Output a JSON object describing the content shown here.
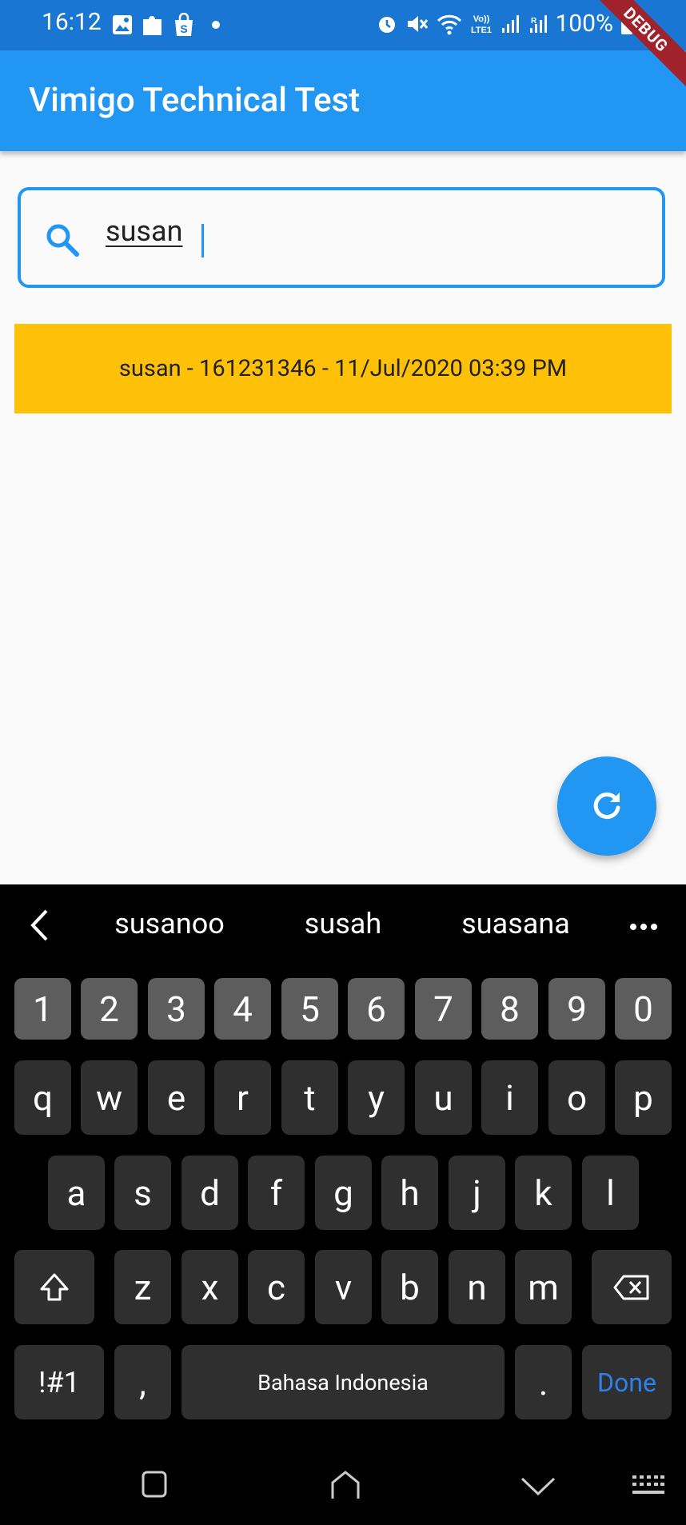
{
  "status_bar": {
    "time": "16:12",
    "battery": "100%",
    "left_icons": [
      "image-icon",
      "puzzle-icon",
      "shop-icon",
      "dot-icon"
    ],
    "right_icons": [
      "alarm-icon",
      "mute-icon",
      "wifi-icon",
      "volte-icon",
      "signal-icon",
      "signal2-icon",
      "battery-icon"
    ]
  },
  "debug_banner": "DEBUG",
  "appbar": {
    "title": "Vimigo Technical Test"
  },
  "search": {
    "value": "susan",
    "icon": "search-icon"
  },
  "results": [
    {
      "text": "susan - 161231346 - 11/Jul/2020 03:39 PM"
    }
  ],
  "fab": {
    "icon": "refresh-icon"
  },
  "keyboard": {
    "suggestions": [
      "susanoo",
      "susah",
      "suasana"
    ],
    "number_row": [
      "1",
      "2",
      "3",
      "4",
      "5",
      "6",
      "7",
      "8",
      "9",
      "0"
    ],
    "row1": [
      "q",
      "w",
      "e",
      "r",
      "t",
      "y",
      "u",
      "i",
      "o",
      "p"
    ],
    "row2": [
      "a",
      "s",
      "d",
      "f",
      "g",
      "h",
      "j",
      "k",
      "l"
    ],
    "row3": [
      "z",
      "x",
      "c",
      "v",
      "b",
      "n",
      "m"
    ],
    "symbols_label": "!#1",
    "comma_label": ",",
    "space_label": "Bahasa Indonesia",
    "period_label": ".",
    "done_label": "Done"
  },
  "colors": {
    "status_bar": "#1976d2",
    "app_bar": "#2196f3",
    "result_bg": "#ffc107",
    "debug": "#a0222a"
  }
}
